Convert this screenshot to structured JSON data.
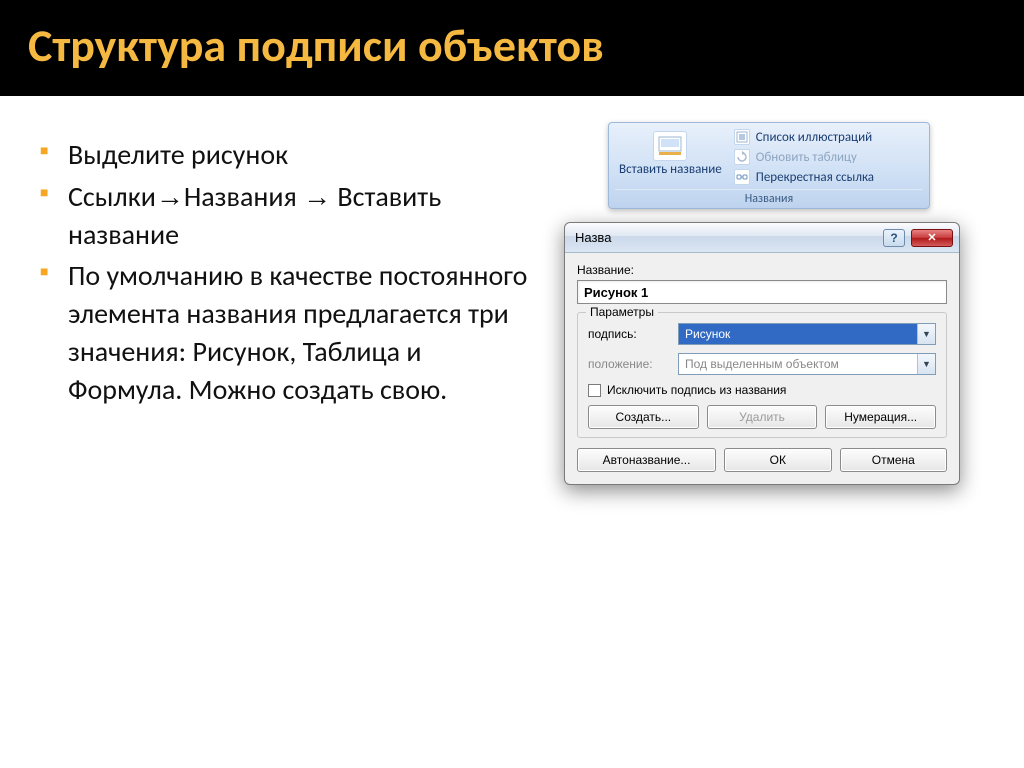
{
  "slide": {
    "title": "Структура подписи объектов"
  },
  "bullets": {
    "b1": "Выделите рисунок",
    "b2_a": "Ссылки",
    "b2_b": "Названия",
    "b2_c": "Вставить название",
    "b3": "По умолчанию в качестве постоянного элемента названия предлагается три значения: Рисунок, Таблица и Формула. Можно создать свою."
  },
  "ribbon": {
    "insert_caption": "Вставить название",
    "list_of_figures": "Список иллюстраций",
    "update_table": "Обновить таблицу",
    "cross_reference": "Перекрестная ссылка",
    "group_label": "Названия"
  },
  "dialog": {
    "title": "Назва",
    "name_label": "Название:",
    "name_value": "Рисунок 1",
    "params_group": "Параметры",
    "label_caption": "подпись:",
    "label_position": "положение:",
    "combo_caption_value": "Рисунок",
    "combo_position_value": "Под выделенным объектом",
    "exclude_checkbox": "Исключить подпись из названия",
    "btn_new": "Создать...",
    "btn_delete": "Удалить",
    "btn_numbering": "Нумерация...",
    "btn_auto": "Автоназвание...",
    "btn_ok": "ОК",
    "btn_cancel": "Отмена"
  }
}
